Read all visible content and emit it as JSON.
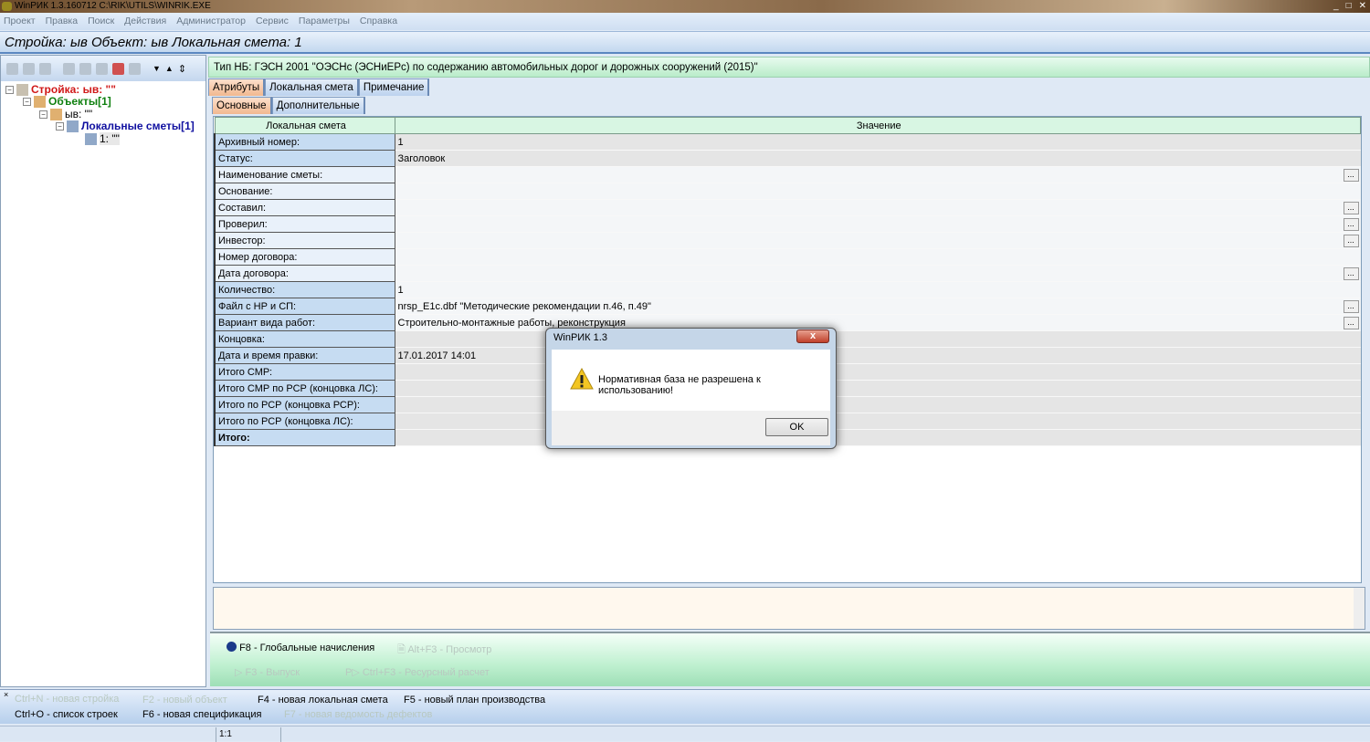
{
  "window": {
    "title": "WinРИК 1.3.160712   C:\\RIK\\UTILS\\WINRIK.EXE",
    "controls": [
      "_",
      "□",
      "✕"
    ]
  },
  "menu": [
    "Проект",
    "Правка",
    "Поиск",
    "Действия",
    "Администратор",
    "Сервис",
    "Параметры",
    "Справка"
  ],
  "header": "Стройка: ыв  Объект: ыв  Локальная смета: 1",
  "tree": {
    "root": "Стройка: ыв: \"\"",
    "objects": "Объекты[1]",
    "object": "ыв: \"\"",
    "estimates": "Локальные сметы[1]",
    "estimate": "1: \"\""
  },
  "nb_info": "Тип НБ: ГЭСН 2001 \"ОЭСНс (ЭСНиЕРс) по содержанию автомобильных дорог и дорожных сооружений (2015)\"",
  "tabs": [
    {
      "label": "Атрибуты",
      "active": true
    },
    {
      "label": "Локальная смета"
    },
    {
      "label": "Примечание"
    }
  ],
  "subtabs": [
    {
      "label": "Основные",
      "active": true
    },
    {
      "label": "Дополнительные"
    }
  ],
  "grid": {
    "headers": [
      "Локальная смета",
      "Значение"
    ],
    "rows": [
      {
        "label": "Архивный номер:",
        "value": "1"
      },
      {
        "label": "Статус:",
        "value": "Заголовок"
      },
      {
        "label": "Наименование сметы:",
        "value": "",
        "button": "..."
      },
      {
        "label": "Основание:",
        "value": ""
      },
      {
        "label": "Составил:",
        "value": "",
        "button": "..."
      },
      {
        "label": "Проверил:",
        "value": "",
        "button": "..."
      },
      {
        "label": "Инвестор:",
        "value": "",
        "button": "..."
      },
      {
        "label": "Номер договора:",
        "value": ""
      },
      {
        "label": "Дата договора:",
        "value": "",
        "button": "..."
      },
      {
        "label": "Количество:",
        "value": "1"
      },
      {
        "label": "Файл с НР и СП:",
        "value": "nrsp_E1c.dbf  \"Методические рекомендации п.46, п.49\"",
        "button": "..."
      },
      {
        "label": "Вариант вида работ:",
        "value": "Строительно-монтажные работы, реконструкция",
        "button": "..."
      },
      {
        "label": "Концовка:",
        "value": ""
      },
      {
        "label": "Дата и время правки:",
        "value": "17.01.2017  14:01"
      },
      {
        "label": "Итого СМР:",
        "value": ""
      },
      {
        "label": "Итого СМР по РСР (концовка ЛС):",
        "value": ""
      },
      {
        "label": "Итого по РСР (концовка РСР):",
        "value": ""
      },
      {
        "label": "Итого по РСР (концовка ЛС):",
        "value": ""
      },
      {
        "label": "Итого:",
        "value": "",
        "bold": true
      }
    ]
  },
  "actions": {
    "global": "F8 - Глобальные начисления",
    "view": "Alt+F3 - Просмотр",
    "release": "F3 - Выпуск",
    "resource": "Ctrl+F3 - Ресурсный расчет"
  },
  "bottom": {
    "new_build": "Ctrl+N - новая стройка",
    "new_object": "F2 - новый объект",
    "new_estimate": "F4 - новая локальная смета",
    "new_plan": "F5 - новый план производства",
    "list": "Ctrl+O - список строек",
    "new_spec": "F6 - новая спецификация",
    "new_defects": "F7 - новая ведомость дефектов"
  },
  "status": {
    "position": "1:1"
  },
  "dialog": {
    "title": "WinРИК 1.3",
    "message": "Нормативная база не разрешена к использованию!",
    "ok": "OK",
    "icon": "warning-icon"
  }
}
